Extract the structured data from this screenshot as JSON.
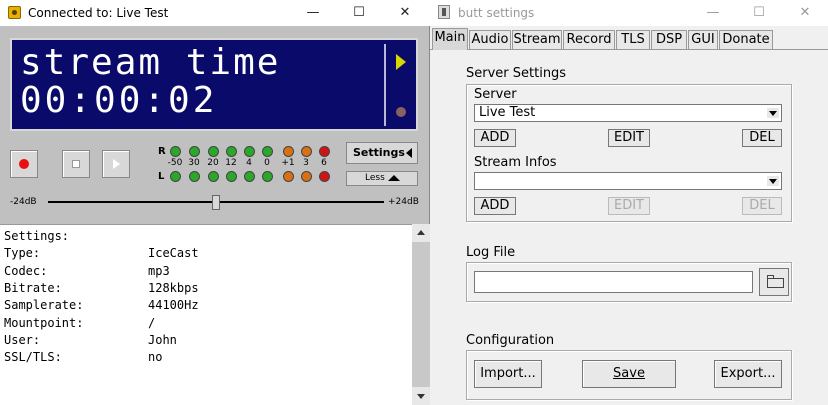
{
  "main_window": {
    "title": "Connected to: Live Test",
    "minimize": "—",
    "maximize": "☐",
    "close": "✕",
    "display": {
      "line1": "stream time",
      "line2": "00:00:02"
    },
    "vu_meter": {
      "rows": [
        "R",
        "L"
      ],
      "labels": [
        "-50",
        "30",
        "20",
        "12",
        "4",
        "0",
        "+1",
        "3",
        "6"
      ],
      "colors": [
        "#2aa82a",
        "#d87014",
        "#d01414"
      ]
    },
    "settings_button": "Settings",
    "less_button": "Less",
    "slider": {
      "min_label": "-24dB",
      "max_label": "+24dB",
      "value": 0.5
    },
    "info": [
      {
        "key": "Settings:",
        "value": ""
      },
      {
        "key": "Type:",
        "value": "IceCast"
      },
      {
        "key": "Codec:",
        "value": "mp3"
      },
      {
        "key": "Bitrate:",
        "value": "128kbps"
      },
      {
        "key": "Samplerate:",
        "value": "44100Hz"
      },
      {
        "key": "Mountpoint:",
        "value": "/"
      },
      {
        "key": "User:",
        "value": "John"
      },
      {
        "key": "SSL/TLS:",
        "value": "no"
      }
    ]
  },
  "settings_window": {
    "title": "butt settings",
    "minimize": "—",
    "maximize": "☐",
    "close": "✕",
    "tabs": [
      "Main",
      "Audio",
      "Stream",
      "Record",
      "TLS",
      "DSP",
      "GUI",
      "Donate"
    ],
    "server_settings": {
      "label": "Server Settings",
      "server_label": "Server",
      "server_value": "Live Test",
      "add": "ADD",
      "edit": "EDIT",
      "del": "DEL",
      "stream_infos_label": "Stream Infos",
      "stream_infos_value": "",
      "add2": "ADD",
      "edit2": "EDIT",
      "del2": "DEL"
    },
    "log_file": {
      "label": "Log File",
      "value": ""
    },
    "configuration": {
      "label": "Configuration",
      "import": "Import...",
      "save": "Save",
      "export": "Export..."
    }
  }
}
